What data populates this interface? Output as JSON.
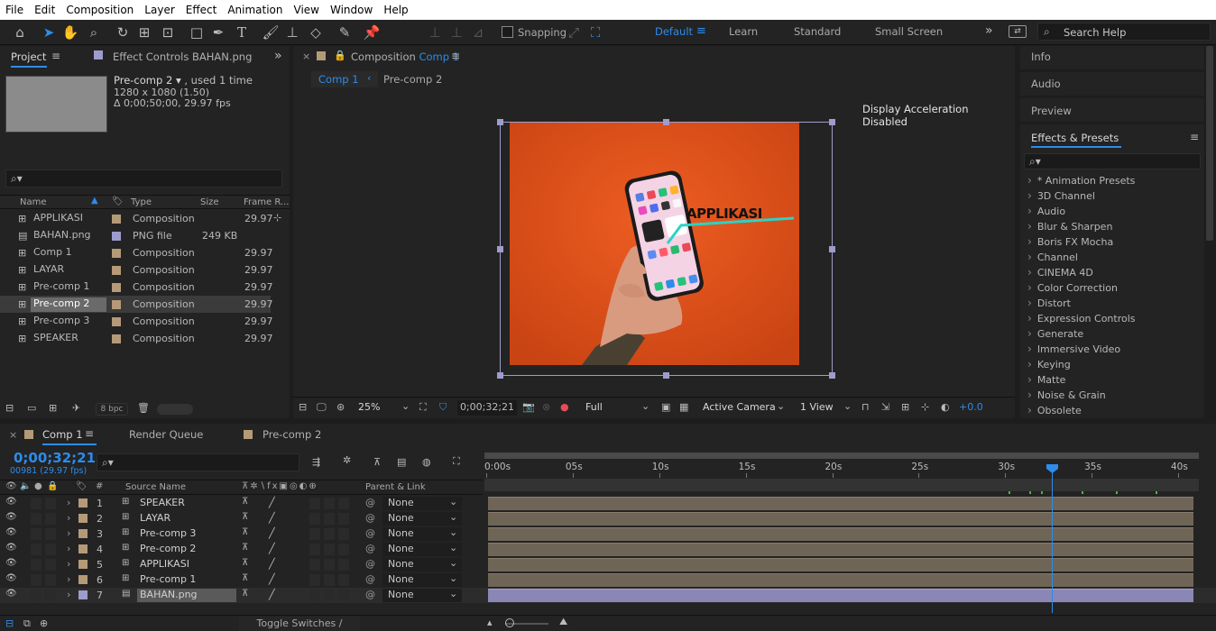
{
  "menu": [
    "File",
    "Edit",
    "Composition",
    "Layer",
    "Effect",
    "Animation",
    "View",
    "Window",
    "Help"
  ],
  "toolbar": {
    "snapping_label": "Snapping",
    "workspaces": [
      "Default",
      "Learn",
      "Standard",
      "Small Screen"
    ],
    "active_workspace": "Default",
    "search_help": "Search Help"
  },
  "project": {
    "tab_project": "Project",
    "tab_effect_controls": "Effect Controls BAHAN.png",
    "selected_name": "Pre-comp 2",
    "used": ", used 1 time",
    "dimensions": "1280 x 1080 (1.50)",
    "duration": "Δ 0;00;50;00, 29.97 fps",
    "columns": {
      "name": "Name",
      "type": "Type",
      "size": "Size",
      "frame_rate": "Frame R..."
    },
    "items": [
      {
        "name": "APPLIKASI",
        "type": "Composition",
        "size": "",
        "fps": "29.97",
        "kind": "comp"
      },
      {
        "name": "BAHAN.png",
        "type": "PNG file",
        "size": "249 KB",
        "fps": "",
        "kind": "png"
      },
      {
        "name": "Comp 1",
        "type": "Composition",
        "size": "",
        "fps": "29.97",
        "kind": "comp"
      },
      {
        "name": "LAYAR",
        "type": "Composition",
        "size": "",
        "fps": "29.97",
        "kind": "comp"
      },
      {
        "name": "Pre-comp 1",
        "type": "Composition",
        "size": "",
        "fps": "29.97",
        "kind": "comp"
      },
      {
        "name": "Pre-comp 2",
        "type": "Composition",
        "size": "",
        "fps": "29.97",
        "kind": "comp"
      },
      {
        "name": "Pre-comp 3",
        "type": "Composition",
        "size": "",
        "fps": "29.97",
        "kind": "comp"
      },
      {
        "name": "SPEAKER",
        "type": "Composition",
        "size": "",
        "fps": "29.97",
        "kind": "comp"
      }
    ],
    "bpc": "8 bpc"
  },
  "composition": {
    "tab_prefix": "Composition",
    "tab_name": "Comp 1",
    "breadcrumb": [
      "Comp 1",
      "Pre-comp 2"
    ],
    "notice": "Display Acceleration Disabled",
    "overlay_text": "APPLIKASI",
    "zoom": "25%",
    "timecode": "0;00;32;21",
    "resolution": "Full",
    "camera": "Active Camera",
    "views": "1 View",
    "exposure": "+0.0"
  },
  "right_panels": {
    "tabs": [
      "Info",
      "Audio",
      "Preview"
    ],
    "effects_title": "Effects & Presets",
    "effects": [
      "* Animation Presets",
      "3D Channel",
      "Audio",
      "Blur & Sharpen",
      "Boris FX Mocha",
      "Channel",
      "CINEMA 4D",
      "Color Correction",
      "Distort",
      "Expression Controls",
      "Generate",
      "Immersive Video",
      "Keying",
      "Matte",
      "Noise & Grain",
      "Obsolete"
    ]
  },
  "timeline": {
    "tabs": [
      "Comp 1",
      "Render Queue",
      "Pre-comp 2"
    ],
    "timecode": "0;00;32;21",
    "frames": "00981 (29.97 fps)",
    "col_source": "Source Name",
    "col_parent": "Parent & Link",
    "ruler": [
      "0:00s",
      "05s",
      "10s",
      "15s",
      "20s",
      "25s",
      "30s",
      "35s",
      "40s"
    ],
    "playhead_seconds": 32.7,
    "ruler_max_seconds": 40,
    "layers": [
      {
        "num": "1",
        "name": "SPEAKER",
        "parent": "None",
        "kind": "comp"
      },
      {
        "num": "2",
        "name": "LAYAR",
        "parent": "None",
        "kind": "comp"
      },
      {
        "num": "3",
        "name": "Pre-comp 3",
        "parent": "None",
        "kind": "comp"
      },
      {
        "num": "4",
        "name": "Pre-comp 2",
        "parent": "None",
        "kind": "comp"
      },
      {
        "num": "5",
        "name": "APPLIKASI",
        "parent": "None",
        "kind": "comp"
      },
      {
        "num": "6",
        "name": "Pre-comp 1",
        "parent": "None",
        "kind": "comp"
      },
      {
        "num": "7",
        "name": "BAHAN.png",
        "parent": "None",
        "kind": "png"
      }
    ],
    "toggle_label": "Toggle Switches / Modes"
  },
  "colors": {
    "accent": "#2d8ceb",
    "comp_label": "#b59a78",
    "png_label": "#9e9ccc",
    "orange_bg": "#e0531f"
  }
}
